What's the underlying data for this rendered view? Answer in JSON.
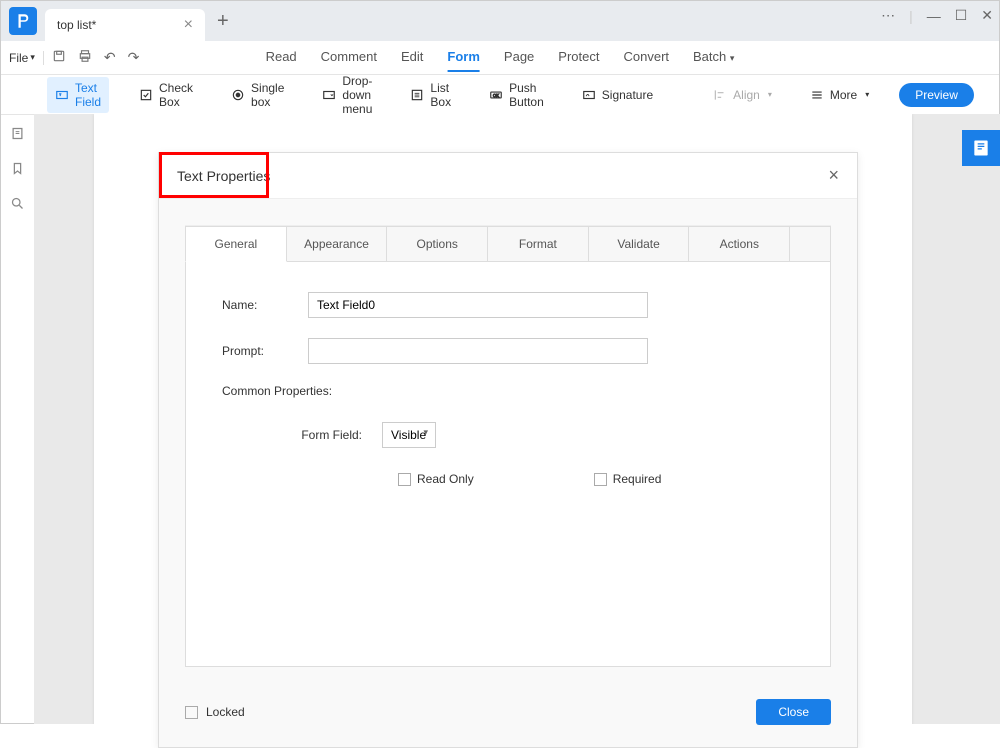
{
  "titlebar": {
    "tab_name": "top list*",
    "app_letter": "P"
  },
  "menu": {
    "file": "File",
    "tabs": [
      "Read",
      "Comment",
      "Edit",
      "Form",
      "Page",
      "Protect",
      "Convert",
      "Batch"
    ],
    "active_tab": "Form"
  },
  "form_toolbar": {
    "text_field": "Text Field",
    "check_box": "Check Box",
    "single_box": "Single box",
    "dropdown": "Drop-down menu",
    "list_box": "List Box",
    "push_button": "Push Button",
    "signature": "Signature",
    "align": "Align",
    "more": "More",
    "preview": "Preview"
  },
  "dialog": {
    "title": "Text Properties",
    "tabs": [
      "General",
      "Appearance",
      "Options",
      "Format",
      "Validate",
      "Actions"
    ],
    "active_tab": "General",
    "name_label": "Name:",
    "name_value": "Text Field0",
    "prompt_label": "Prompt:",
    "prompt_value": "",
    "common_label": "Common Properties:",
    "form_field_label": "Form Field:",
    "form_field_value": "Visible",
    "read_only": "Read Only",
    "required": "Required",
    "locked": "Locked",
    "close": "Close"
  }
}
